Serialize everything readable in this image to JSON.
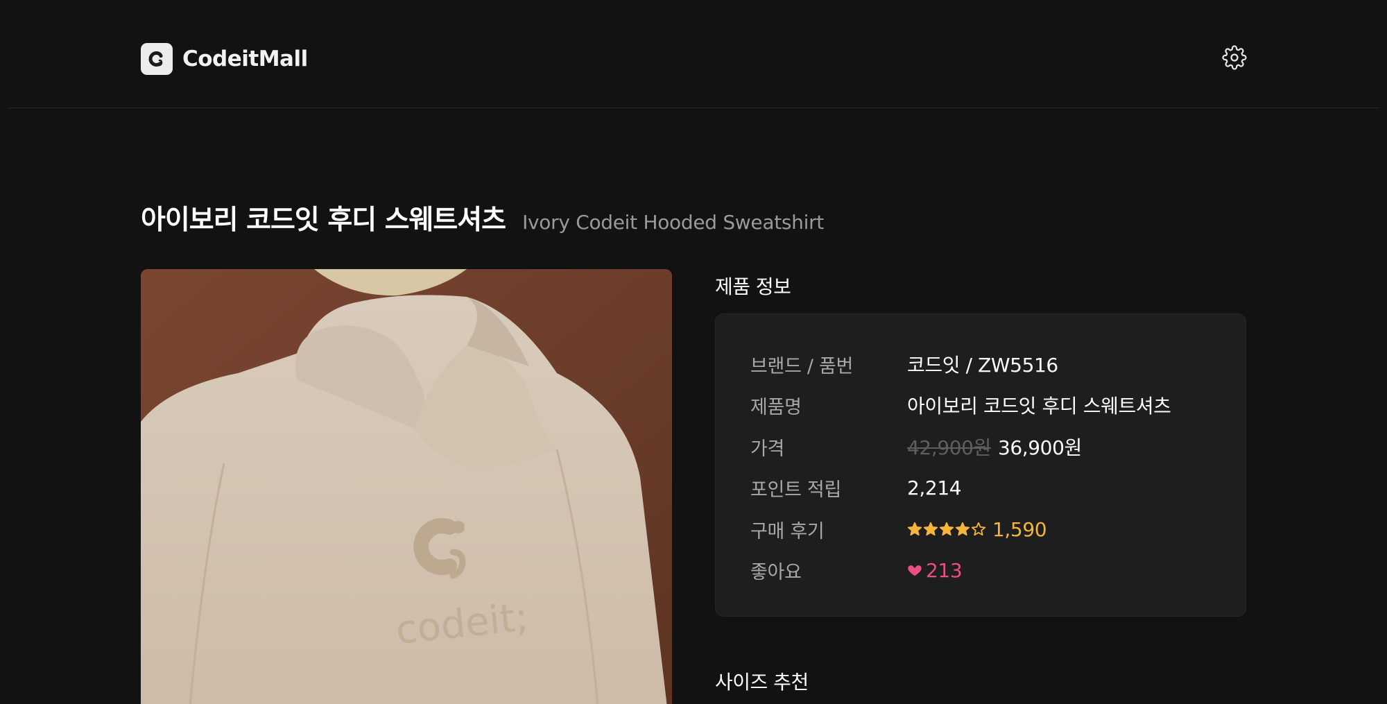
{
  "header": {
    "brand": "CodeitMall",
    "logo_icon": "codeit-logo-icon",
    "settings_icon": "gear-icon"
  },
  "product": {
    "title_ko": "아이보리 코드잇 후디 스웨트셔츠",
    "title_en": "Ivory Codeit Hooded Sweatshirt",
    "image_alt": "codeit;"
  },
  "info": {
    "section_title": "제품 정보",
    "rows": [
      {
        "label": "브랜드 / 품번",
        "value": "코드잇 / ZW5516"
      },
      {
        "label": "제품명",
        "value": "아이보리 코드잇 후디 스웨트셔츠"
      },
      {
        "label": "가격",
        "original_price": "42,900원",
        "price": "36,900원"
      },
      {
        "label": "포인트 적립",
        "value": "2,214"
      },
      {
        "label": "구매 후기",
        "stars": 4,
        "stars_max": 5,
        "count": "1,590"
      },
      {
        "label": "좋아요",
        "count": "213"
      }
    ]
  },
  "size": {
    "section_title": "사이즈 추천"
  },
  "colors": {
    "background": "#121212",
    "card": "#1e1e1e",
    "star": "#f5b53c",
    "like": "#ea4f7f"
  }
}
